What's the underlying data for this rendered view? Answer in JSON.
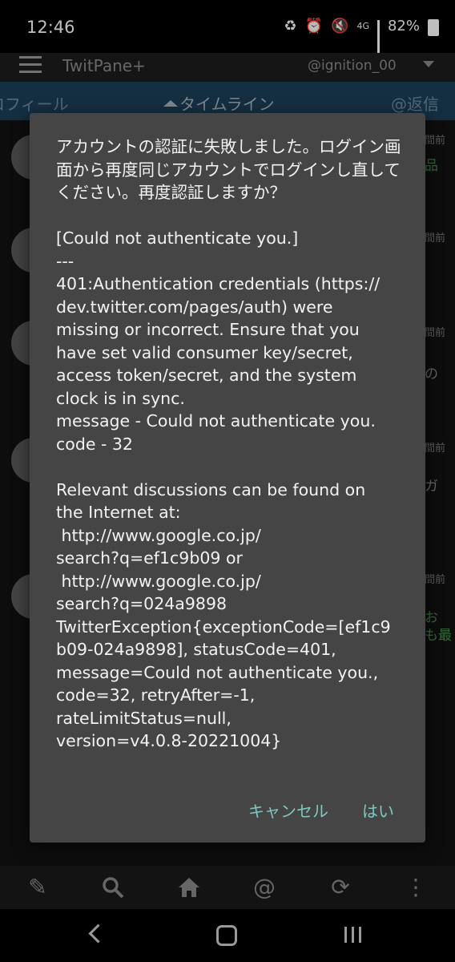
{
  "status_bar": {
    "time": "12:46",
    "network": "4G",
    "battery": "82%",
    "icons": [
      "recycle-icon",
      "alarm-icon",
      "mute-icon",
      "network-4g-icon",
      "signal-icon",
      "battery-icon"
    ]
  },
  "app_bar": {
    "title": "TwitPane+",
    "account": "@ignition_00"
  },
  "tabs": {
    "profile": "ロフィール",
    "timeline": "タイムライン",
    "reply": "@返信"
  },
  "timeline_items": [
    {
      "time": "間前",
      "snippet": "品"
    },
    {
      "time": "間前",
      "snippet": ""
    },
    {
      "time": "間前",
      "snippet": "の"
    },
    {
      "time": "間前",
      "snippet": "ガ"
    },
    {
      "time": "間前",
      "snippet": "お\nも最"
    }
  ],
  "dialog": {
    "message": "アカウントの認証に失敗しました。ログイン画面から再度同じアカウントでログインし直してください。再度認証しますか？\n\n[Could not authenticate you.]\n---\n401:Authentication credentials (https://\ndev.twitter.com/pages/auth) were\nmissing or incorrect. Ensure that you\nhave set valid consumer key/secret,\naccess token/secret, and the system\nclock is in sync.\nmessage - Could not authenticate you.\ncode - 32\n\nRelevant discussions can be found on\nthe Internet at:\n http://www.google.co.jp/\nsearch?q=ef1c9b09 or\n http://www.google.co.jp/\nsearch?q=024a9898\nTwitterException{exceptionCode=[ef1c9\nb09-024a9898], statusCode=401,\nmessage=Could not authenticate you.,\ncode=32, retryAfter=-1,\nrateLimitStatus=null,\nversion=v4.0.8-20221004}",
    "cancel_label": "キャンセル",
    "yes_label": "はい"
  },
  "toolbar": {
    "icons": [
      "compose-icon",
      "search-icon",
      "home-icon",
      "mention-icon",
      "refresh-icon",
      "more-icon"
    ]
  },
  "colors": {
    "tab_bar": "#1d3f58",
    "dialog_bg": "#454545",
    "dialog_button": "#7fc7c0"
  }
}
